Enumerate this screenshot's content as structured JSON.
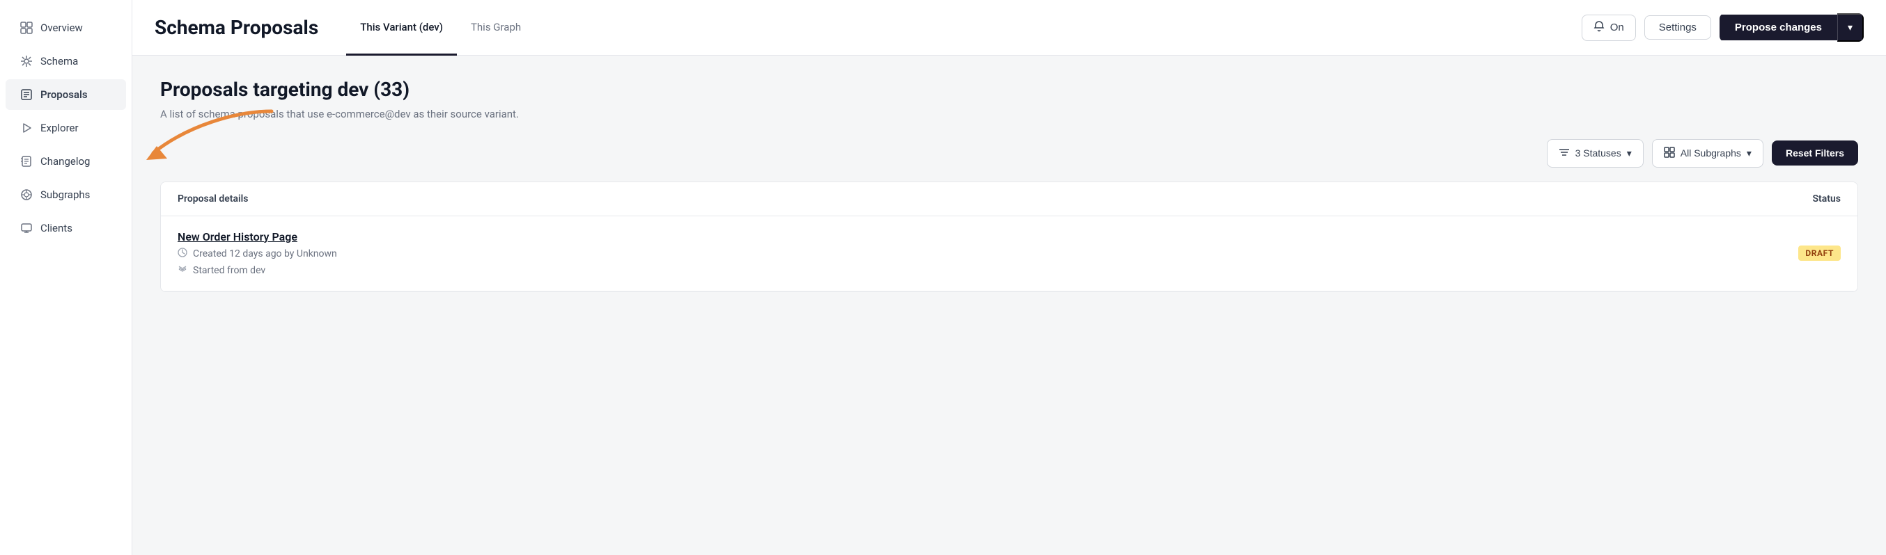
{
  "sidebar": {
    "items": [
      {
        "id": "overview",
        "label": "Overview",
        "icon": "🏠",
        "active": false
      },
      {
        "id": "schema",
        "label": "Schema",
        "icon": "✦",
        "active": false
      },
      {
        "id": "proposals",
        "label": "Proposals",
        "icon": "📋",
        "active": true
      },
      {
        "id": "explorer",
        "label": "Explorer",
        "icon": "▶",
        "active": false
      },
      {
        "id": "changelog",
        "label": "Changelog",
        "icon": "⊞",
        "active": false
      },
      {
        "id": "subgraphs",
        "label": "Subgraphs",
        "icon": "⚙",
        "active": false
      },
      {
        "id": "clients",
        "label": "Clients",
        "icon": "🖥",
        "active": false
      }
    ]
  },
  "header": {
    "title": "Schema Proposals",
    "tabs": [
      {
        "id": "this-variant",
        "label": "This Variant (dev)",
        "active": true
      },
      {
        "id": "this-graph",
        "label": "This Graph",
        "active": false
      }
    ],
    "bell_label": "On",
    "settings_label": "Settings",
    "propose_changes_label": "Propose changes"
  },
  "content": {
    "title": "Proposals targeting dev (33)",
    "subtitle": "A list of schema proposals that use e-commerce@dev as their source variant.",
    "filters": {
      "statuses_label": "3 Statuses",
      "subgraphs_label": "All Subgraphs",
      "reset_label": "Reset Filters"
    },
    "table": {
      "col_proposal": "Proposal details",
      "col_status": "Status",
      "rows": [
        {
          "name": "New Order History Page",
          "created": "Created 12 days ago by Unknown",
          "started": "Started from dev",
          "status": "DRAFT"
        }
      ]
    }
  }
}
